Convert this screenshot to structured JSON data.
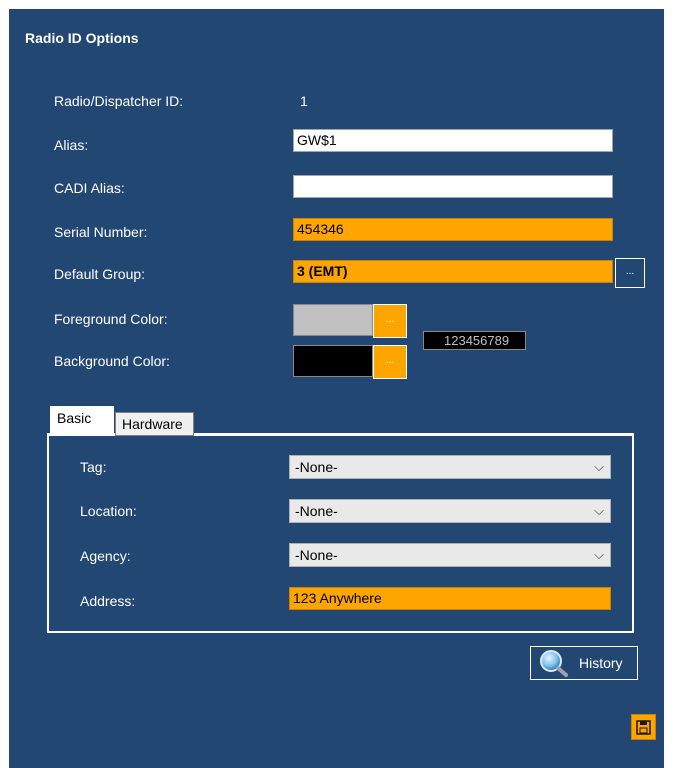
{
  "header": {
    "title": "Radio ID Options"
  },
  "form": {
    "radio_id_label": "Radio/Dispatcher ID:",
    "radio_id_value": "1",
    "alias_label": "Alias:",
    "alias_value": "GW$1",
    "cadi_alias_label": "CADI Alias:",
    "cadi_alias_value": "",
    "serial_label": "Serial Number:",
    "serial_value": "454346",
    "default_group_label": "Default Group:",
    "default_group_value": "3 (EMT)",
    "ellipsis": "...",
    "foreground_label": "Foreground Color:",
    "background_label": "Background Color:",
    "preview_text": "123456789"
  },
  "colors": {
    "panel": "#234773",
    "accent": "#ffa500",
    "foreground_swatch": "#c0c0c0",
    "background_swatch": "#000000"
  },
  "tabs": [
    {
      "label": "Basic",
      "active": true
    },
    {
      "label": "Hardware",
      "active": false
    }
  ],
  "basic": {
    "tag_label": "Tag:",
    "tag_value": "-None-",
    "location_label": "Location:",
    "location_value": "-None-",
    "agency_label": "Agency:",
    "agency_value": "-None-",
    "address_label": "Address:",
    "address_value": "123 Anywhere"
  },
  "footer": {
    "history_label": "History",
    "history_icon": "magnifier-icon",
    "save_icon": "floppy-disk-icon"
  }
}
